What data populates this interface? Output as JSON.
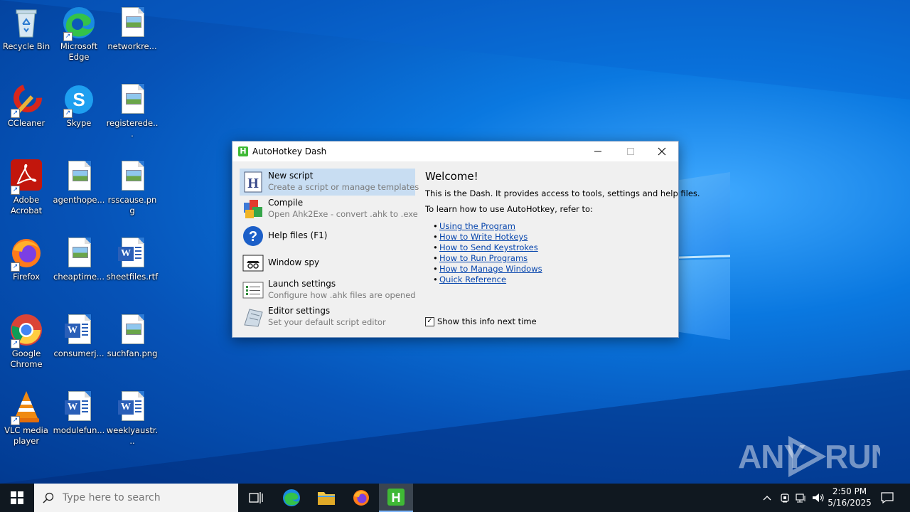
{
  "desktop_icons": [
    {
      "label": "Recycle Bin",
      "icon": "recycle-bin-icon"
    },
    {
      "label": "Microsoft Edge",
      "icon": "edge-icon"
    },
    {
      "label": "networkre...",
      "icon": "image-file-icon"
    },
    {
      "label": "CCleaner",
      "icon": "ccleaner-icon"
    },
    {
      "label": "Skype",
      "icon": "skype-icon"
    },
    {
      "label": "registerede...",
      "icon": "image-file-icon"
    },
    {
      "label": "Adobe Acrobat",
      "icon": "acrobat-icon"
    },
    {
      "label": "agenthope...",
      "icon": "image-file-icon"
    },
    {
      "label": "rsscause.png",
      "icon": "image-file-icon"
    },
    {
      "label": "Firefox",
      "icon": "firefox-icon"
    },
    {
      "label": "cheaptime...",
      "icon": "image-file-icon"
    },
    {
      "label": "sheetfiles.rtf",
      "icon": "word-doc-icon"
    },
    {
      "label": "Google Chrome",
      "icon": "chrome-icon"
    },
    {
      "label": "consumerj...",
      "icon": "word-doc-icon"
    },
    {
      "label": "suchfan.png",
      "icon": "image-file-icon"
    },
    {
      "label": "VLC media player",
      "icon": "vlc-icon"
    },
    {
      "label": "modulefun...",
      "icon": "word-doc-icon"
    },
    {
      "label": "weeklyaustr...",
      "icon": "word-doc-icon"
    }
  ],
  "window": {
    "title": "AutoHotkey Dash",
    "items": [
      {
        "title": "New script",
        "subtitle": "Create a script or manage templates"
      },
      {
        "title": "Compile",
        "subtitle": "Open Ahk2Exe - convert .ahk to .exe"
      },
      {
        "title": "Help files (F1)",
        "subtitle": ""
      },
      {
        "title": "Window spy",
        "subtitle": ""
      },
      {
        "title": "Launch settings",
        "subtitle": "Configure how .ahk files are opened"
      },
      {
        "title": "Editor settings",
        "subtitle": "Set your default script editor"
      }
    ],
    "welcome": "Welcome!",
    "intro": "This is the Dash. It provides access to tools, settings and help files.",
    "learn": "To learn how to use AutoHotkey, refer to:",
    "links": [
      "Using the Program",
      "How to Write Hotkeys",
      "How to Send Keystrokes",
      "How to Run Programs",
      "How to Manage Windows",
      "Quick Reference"
    ],
    "show_info_label": "Show this info next time",
    "show_info_checked": true
  },
  "taskbar": {
    "search_placeholder": "Type here to search",
    "time": "2:50 PM",
    "date": "5/16/2025"
  },
  "watermark": "ANY RUN"
}
